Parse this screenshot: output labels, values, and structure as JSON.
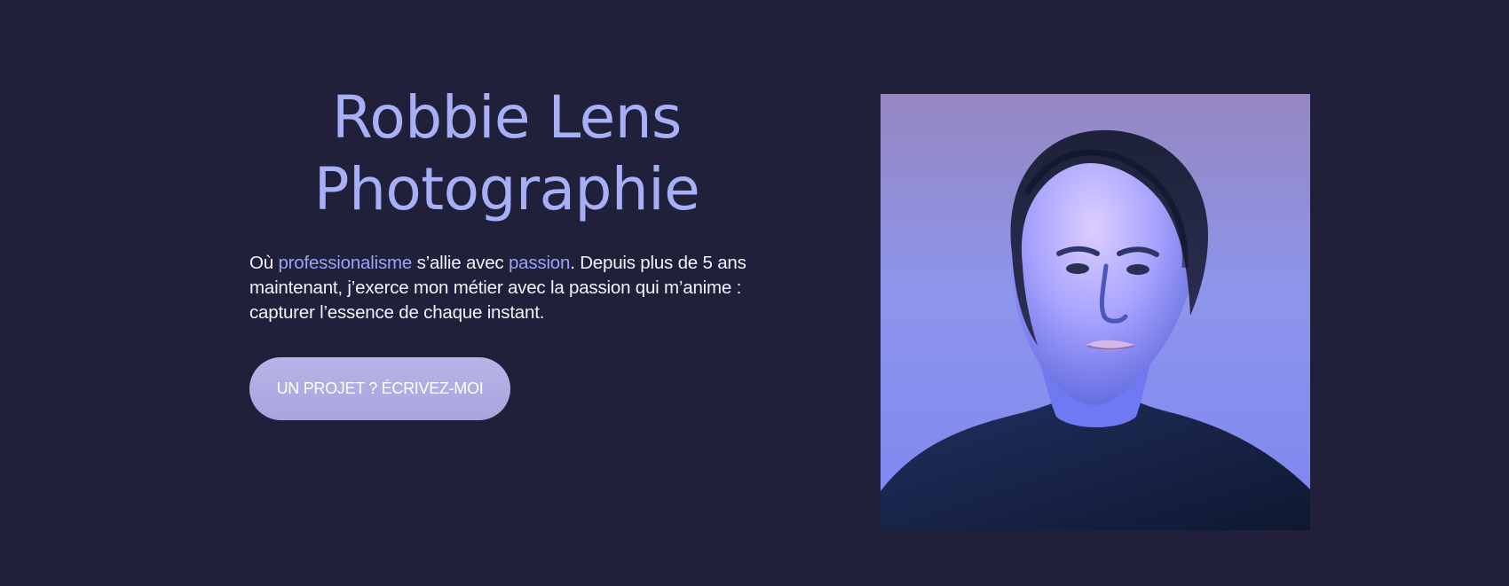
{
  "hero": {
    "title_line_1": "Robbie Lens",
    "title_line_2": "Photographie",
    "intro": {
      "before_1": "Où ",
      "highlight_1": "professionalisme",
      "middle": " s’allie avec ",
      "highlight_2": "passion",
      "after": ". Depuis plus de 5 ans maintenant, j’exerce mon métier avec la passion qui m’anime : capturer l’essence de chaque instant."
    },
    "cta_label": "UN PROJET ? ÉCRIVEZ-MOI"
  },
  "colors": {
    "background": "#20203b",
    "title": "#a7b0f7",
    "highlight": "#9aa4f6",
    "button": "#b2ade4"
  }
}
